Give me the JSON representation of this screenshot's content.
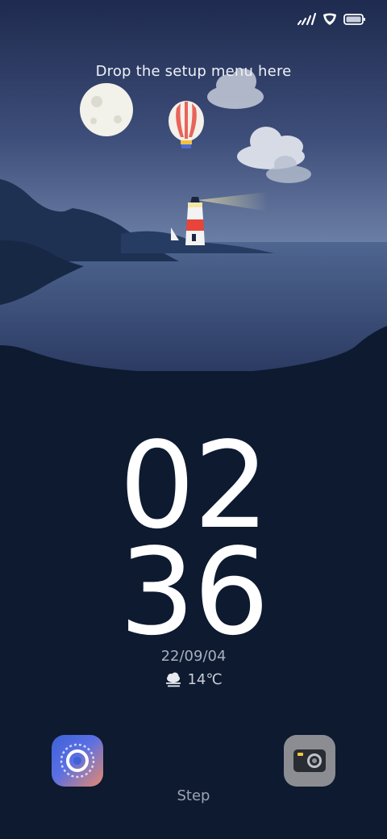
{
  "status_bar": {
    "icons": [
      "signal-icon",
      "shield-icon",
      "battery-icon"
    ]
  },
  "wallpaper": {
    "hint": "Drop the setup menu here"
  },
  "clock": {
    "hours": "02",
    "minutes": "36",
    "date": "22/09/04"
  },
  "weather": {
    "icon": "cloud-fog-icon",
    "temperature": "14℃"
  },
  "shortcuts": {
    "left_icon": "step-app-icon",
    "right_icon": "camera-icon",
    "label": "Step"
  },
  "colors": {
    "sky_top": "#1e2a4e",
    "sky_bottom": "#6a7ea6",
    "ground": "#0d1a30"
  }
}
